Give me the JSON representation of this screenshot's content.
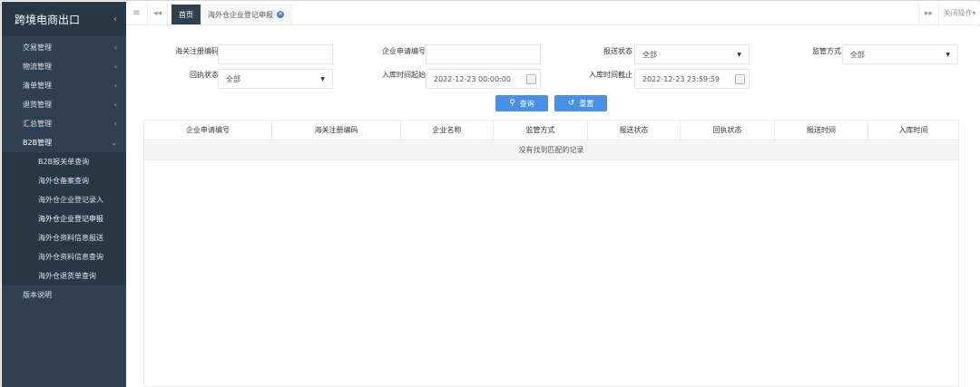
{
  "app": {
    "title": "跨境电商出口"
  },
  "sidebar": {
    "items": [
      {
        "label": "交易管理"
      },
      {
        "label": "物流管理"
      },
      {
        "label": "清单管理"
      },
      {
        "label": "退货管理"
      },
      {
        "label": "汇总管理"
      },
      {
        "label": "B2B管理"
      }
    ],
    "sub_items": [
      {
        "label": "B2B报关单查询"
      },
      {
        "label": "海外仓备案查询"
      },
      {
        "label": "海外仓企业登记录入"
      },
      {
        "label": "海外仓企业登记申报"
      },
      {
        "label": "海外仓资料信息报送"
      },
      {
        "label": "海外仓资料信息查询"
      },
      {
        "label": "海外仓退货单查询"
      }
    ],
    "footer_item": {
      "label": "版本说明"
    }
  },
  "tabs": {
    "home": "首页",
    "current": "海外仓企业登记申报",
    "close_ops": "关闭操作"
  },
  "form": {
    "customs_reg_code": {
      "label": "海关注册编码",
      "value": ""
    },
    "company_app_no": {
      "label": "企业申请编号",
      "value": ""
    },
    "report_status": {
      "label": "报送状态",
      "value": "全部"
    },
    "supervision_mode": {
      "label": "监管方式",
      "value": "全部"
    },
    "receipt_status": {
      "label": "回执状态",
      "value": "全部"
    },
    "inbound_start": {
      "label": "入库时间起始",
      "value": "2022-12-23 00:00:00"
    },
    "inbound_end": {
      "label": "入库时间截止",
      "value": "2022-12-23 23:59:59"
    },
    "search_button": "查询",
    "reset_button": "重置"
  },
  "table": {
    "columns": [
      "企业申请编号",
      "海关注册编码",
      "企业名称",
      "监管方式",
      "报送状态",
      "回执状态",
      "报送时间",
      "入库时间"
    ],
    "empty_text": "没有找到匹配的记录"
  },
  "colors": {
    "sidebar_bg": "#2f4050",
    "primary": "#4a90e2"
  }
}
